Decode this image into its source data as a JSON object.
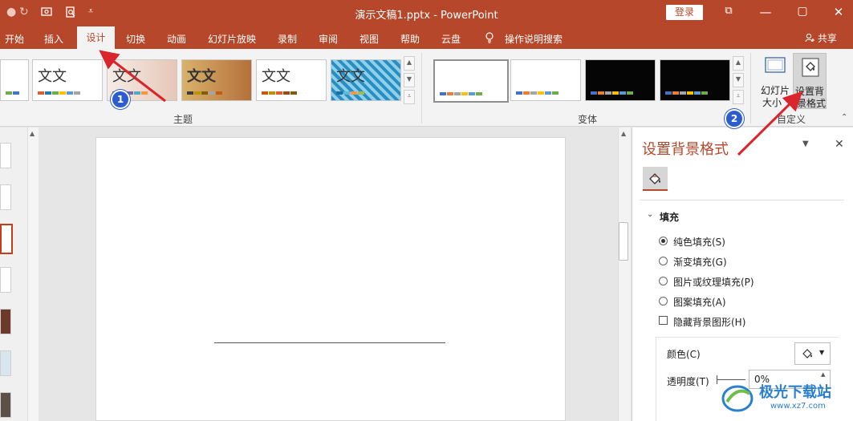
{
  "titlebar": {
    "document_title": "演示文稿1.pptx  -  PowerPoint",
    "login_label": "登录",
    "undo_glyph": "↶",
    "redo_glyph": "↻",
    "minimize_glyph": "—",
    "restore_glyph": "▢",
    "close_glyph": "✕",
    "ribbon_display_glyph": "⧉"
  },
  "tabs": [
    {
      "label": "开始"
    },
    {
      "label": "插入"
    },
    {
      "label": "设计"
    },
    {
      "label": "切换"
    },
    {
      "label": "动画"
    },
    {
      "label": "幻灯片放映"
    },
    {
      "label": "录制"
    },
    {
      "label": "审阅"
    },
    {
      "label": "视图"
    },
    {
      "label": "帮助"
    },
    {
      "label": "云盘"
    },
    {
      "label": "操作说明搜索"
    }
  ],
  "share_label": "共享",
  "ribbon": {
    "themes_group_label": "主题",
    "variants_group_label": "变体",
    "customize_group_label": "自定义",
    "theme_sample_text": "文文",
    "slide_size_label_1": "幻灯片",
    "slide_size_label_2": "大小",
    "format_bg_label_1": "设置背",
    "format_bg_label_2": "景格式"
  },
  "pane": {
    "title": "设置背景格式",
    "section_fill": "填充",
    "options": [
      {
        "label": "纯色填充(S)",
        "selected": true
      },
      {
        "label": "渐变填充(G)",
        "selected": false
      },
      {
        "label": "图片或纹理填充(P)",
        "selected": false
      },
      {
        "label": "图案填充(A)",
        "selected": false
      }
    ],
    "hide_graphics_label": "隐藏背景图形(H)",
    "color_label": "颜色(C)",
    "transparency_label": "透明度(T)",
    "transparency_value": "0%"
  },
  "annotations": {
    "badge_1": "1",
    "badge_2": "2"
  },
  "watermark": {
    "text": "极光下载站",
    "subtext": "www.xz7.com"
  },
  "colors": {
    "accent": "#b7472a",
    "annotation_arrow": "#d9262c",
    "badge_blue": "#2d5bd0"
  }
}
